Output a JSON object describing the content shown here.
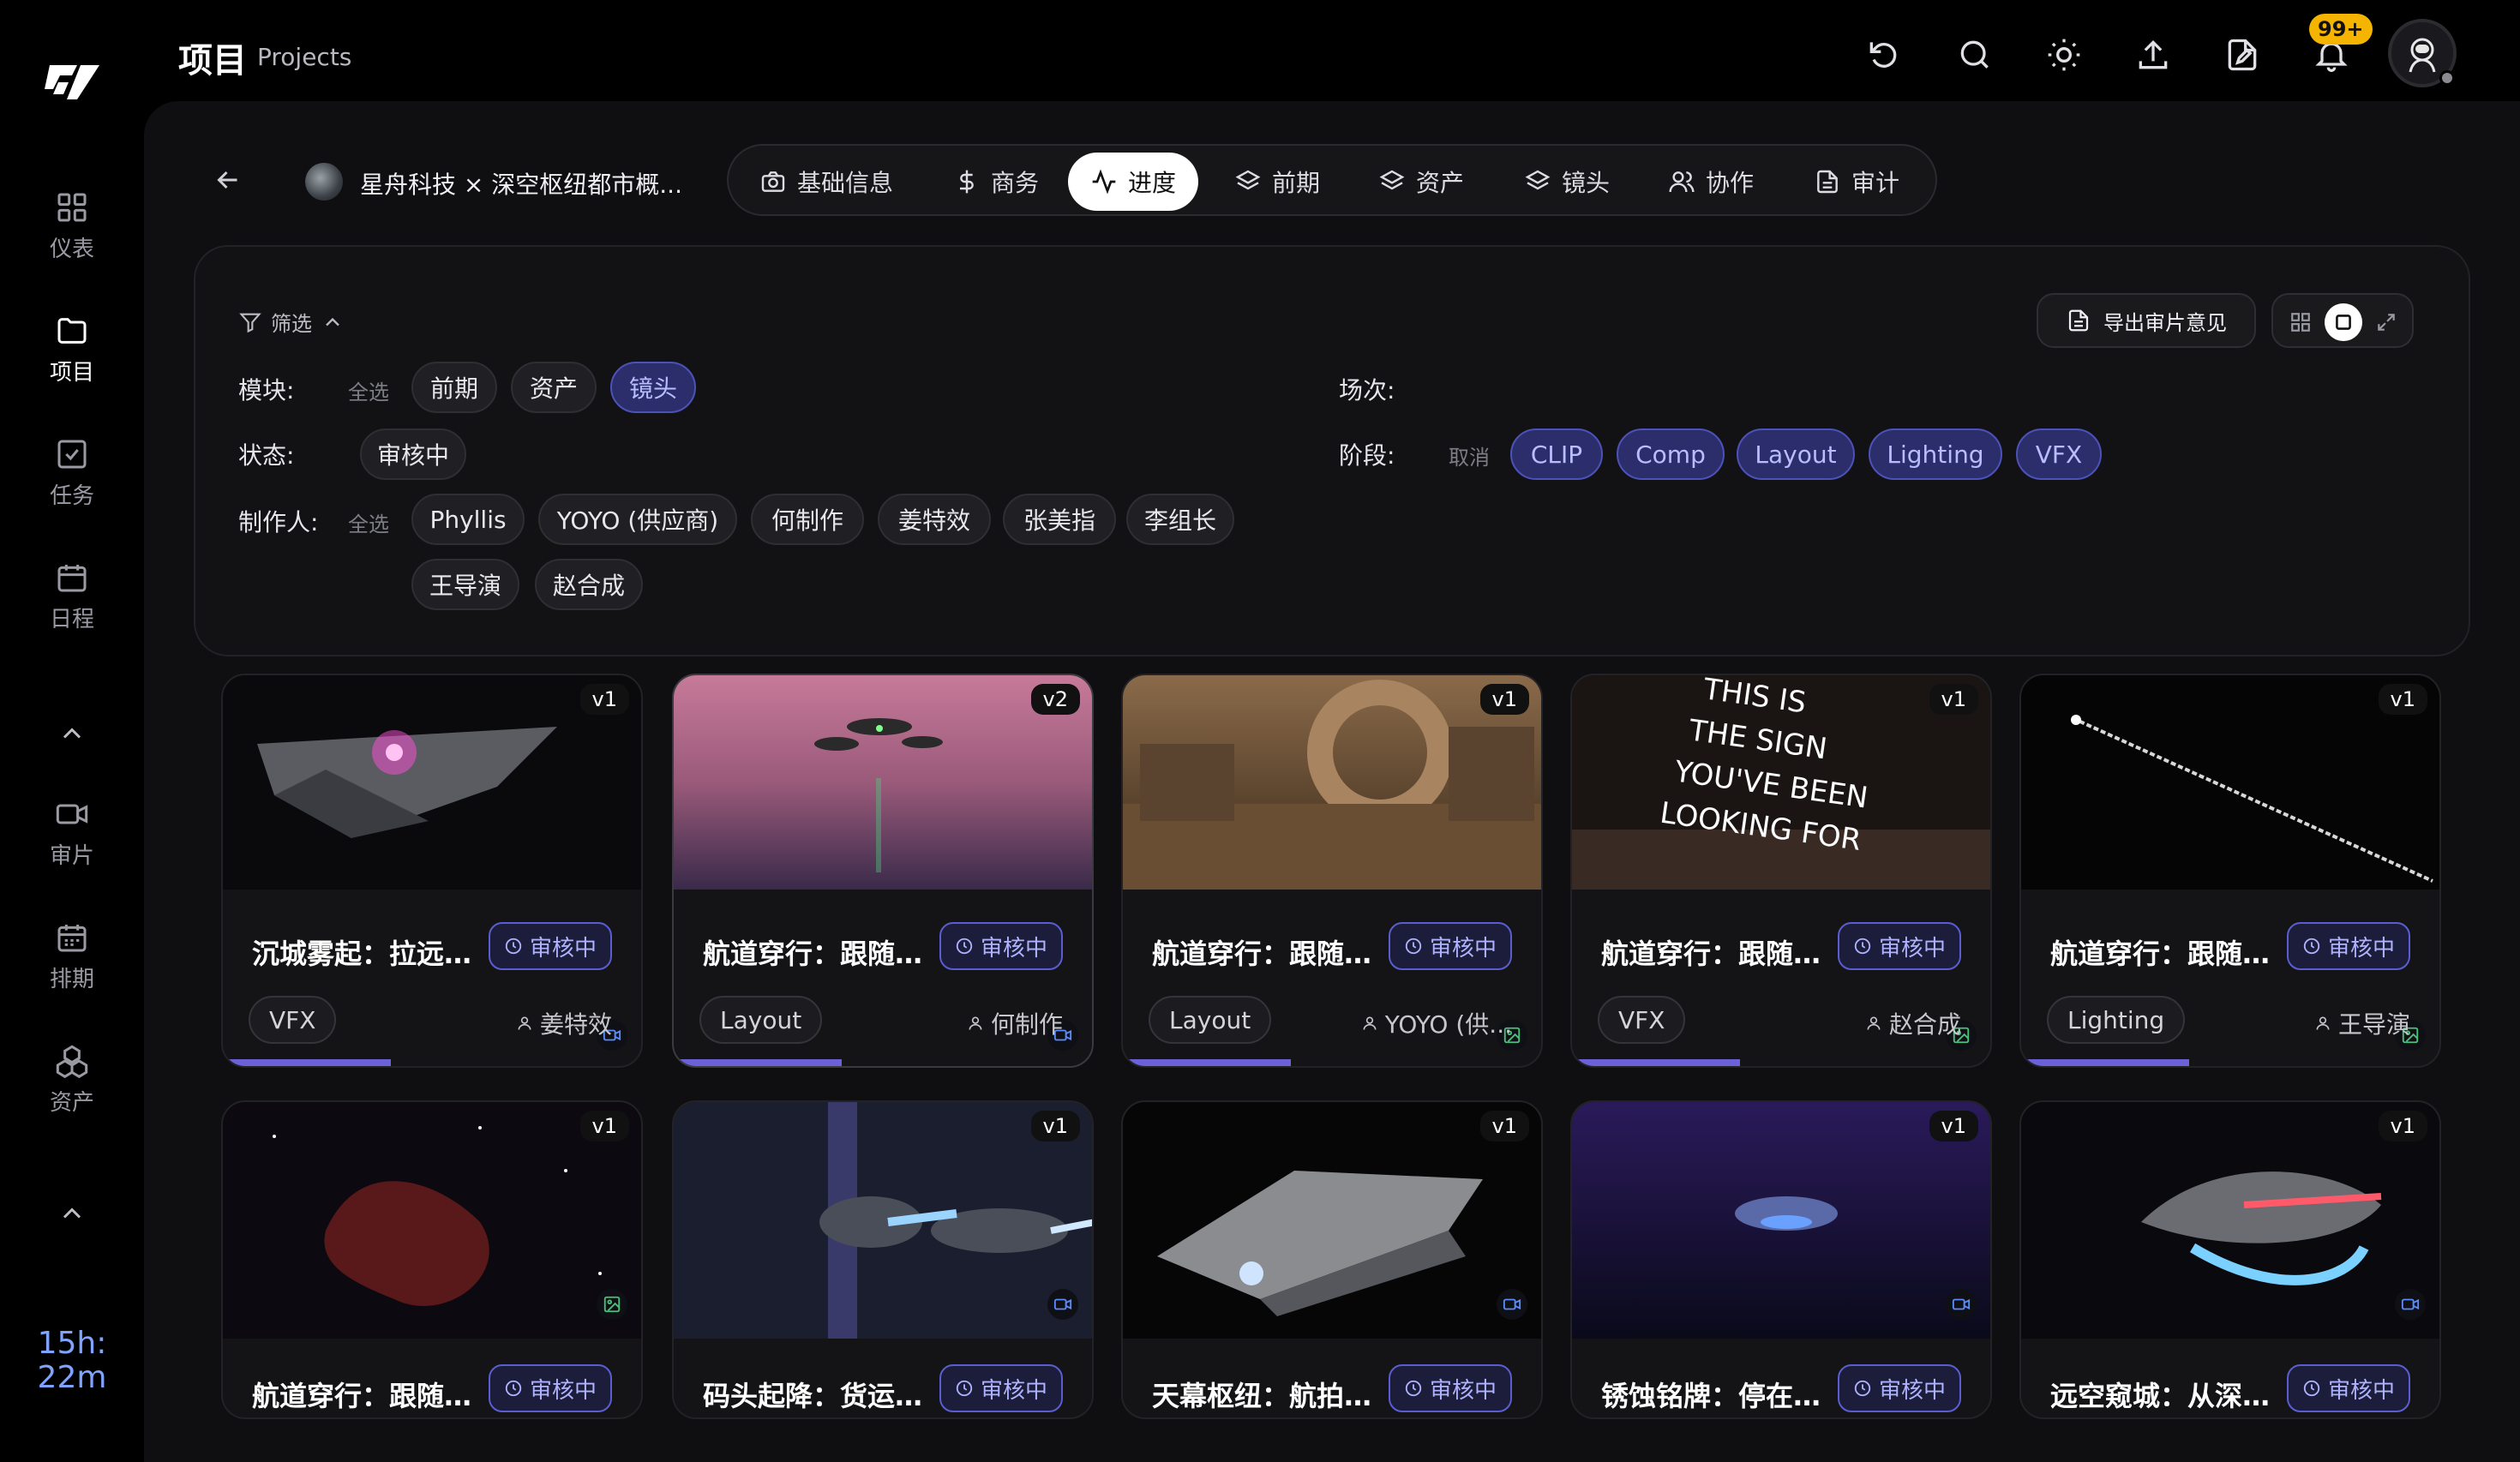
{
  "window": {
    "traffic_colors": [
      "#ff5f57",
      "#febc2e",
      "#28c840"
    ]
  },
  "header": {
    "title": "项目",
    "subtitle": "Projects",
    "notifications_badge": "99+"
  },
  "sidebar": {
    "items": [
      {
        "label": "仪表",
        "icon": "grid-icon"
      },
      {
        "label": "项目",
        "icon": "folder-icon",
        "active": true
      },
      {
        "label": "任务",
        "icon": "checkbox-icon"
      },
      {
        "label": "日程",
        "icon": "calendar-icon"
      },
      {
        "label": "审片",
        "icon": "video-icon"
      },
      {
        "label": "排期",
        "icon": "schedule-icon"
      },
      {
        "label": "资产",
        "icon": "assets-icon"
      }
    ],
    "timer": {
      "hours": "15h:",
      "minutes": "22m"
    }
  },
  "project": {
    "name": "星舟科技 × 深空枢纽都市概..."
  },
  "tabs": [
    {
      "label": "基础信息",
      "icon": "camera-icon"
    },
    {
      "label": "商务",
      "icon": "dollar-icon"
    },
    {
      "label": "进度",
      "icon": "activity-icon",
      "active": true
    },
    {
      "label": "前期",
      "icon": "layers-icon"
    },
    {
      "label": "资产",
      "icon": "layers-icon"
    },
    {
      "label": "镜头",
      "icon": "layers-icon"
    },
    {
      "label": "协作",
      "icon": "users-icon"
    },
    {
      "label": "审计",
      "icon": "file-icon"
    }
  ],
  "filter": {
    "toggle_label": "筛选",
    "module": {
      "label": "模块:",
      "select_all": "全选",
      "chips": [
        "前期",
        "资产",
        "镜头"
      ]
    },
    "status": {
      "label": "状态:",
      "chips": [
        "审核中"
      ]
    },
    "maker": {
      "label": "制作人:",
      "select_all": "全选",
      "chips": [
        "Phyllis",
        "YOYO (供应商)",
        "何制作",
        "姜特效",
        "张美指",
        "李组长",
        "王导演",
        "赵合成"
      ]
    },
    "scene": {
      "label": "场次:"
    },
    "stage": {
      "label": "阶段:",
      "cancel": "取消",
      "chips": [
        "CLIP",
        "Comp",
        "Layout",
        "Lighting",
        "VFX"
      ]
    },
    "export_label": "导出审片意见"
  },
  "cards": [
    {
      "name": "沉城雾起：拉远...",
      "version": "v1",
      "status": "审核中",
      "stage": "VFX",
      "owner": "姜特效",
      "media": "video",
      "progress": 0.4
    },
    {
      "name": "航道穿行：跟随...",
      "version": "v2",
      "status": "审核中",
      "stage": "Layout",
      "owner": "何制作",
      "media": "video",
      "progress": 0.4
    },
    {
      "name": "航道穿行：跟随...",
      "version": "v1",
      "status": "审核中",
      "stage": "Layout",
      "owner": "YOYO (供...",
      "media": "image",
      "progress": 0.4
    },
    {
      "name": "航道穿行：跟随...",
      "version": "v1",
      "status": "审核中",
      "stage": "VFX",
      "owner": "赵合成",
      "media": "image",
      "progress": 0.4
    },
    {
      "name": "航道穿行：跟随...",
      "version": "v1",
      "status": "审核中",
      "stage": "Lighting",
      "owner": "王导演",
      "media": "image",
      "progress": 0.4
    },
    {
      "name": "航道穿行：跟随...",
      "version": "v1",
      "status": "审核中",
      "media": "image"
    },
    {
      "name": "码头起降：货运...",
      "version": "v1",
      "status": "审核中",
      "media": "video"
    },
    {
      "name": "天幕枢纽：航拍...",
      "version": "v1",
      "status": "审核中",
      "media": "video"
    },
    {
      "name": "锈蚀铭牌：停在...",
      "version": "v1",
      "status": "审核中",
      "media": "video"
    },
    {
      "name": "远空窥城：从深...",
      "version": "v1",
      "status": "审核中",
      "media": "video"
    }
  ],
  "colors": {
    "accent": "#6a62d6",
    "status_border": "#5a5ed0",
    "timer": "#7fa3ff",
    "badge": "#f5b400"
  }
}
